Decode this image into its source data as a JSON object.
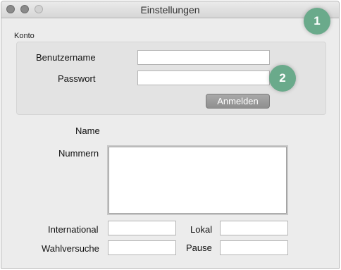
{
  "window": {
    "title": "Einstellungen"
  },
  "account": {
    "group_label": "Konto",
    "username_label": "Benutzername",
    "username_value": "",
    "password_label": "Passwort",
    "password_value": "",
    "login_label": "Anmelden"
  },
  "details": {
    "name_label": "Name",
    "numbers_label": "Nummern",
    "numbers_value": "",
    "international_label": "International",
    "international_value": "",
    "local_label": "Lokal",
    "local_value": "",
    "redial_label": "Wahlversuche",
    "redial_value": "",
    "pause_label": "Pause",
    "pause_value": ""
  },
  "annotations": {
    "badge_1": "1",
    "badge_2": "2"
  },
  "colors": {
    "badge": "#6aaa8b",
    "button": "#999999"
  }
}
